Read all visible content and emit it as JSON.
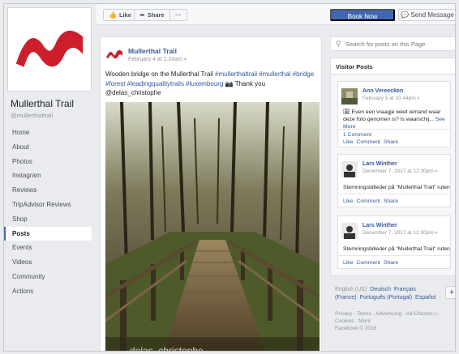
{
  "page": {
    "name": "Mullerthal Trail",
    "handle": "@mullerthaltrail"
  },
  "nav": {
    "items": [
      "Home",
      "About",
      "Photos",
      "Instagram",
      "Reviews",
      "TripAdvisor Reviews",
      "Shop",
      "Posts",
      "Events",
      "Videos",
      "Community",
      "Actions"
    ],
    "active": "Posts"
  },
  "actionbar": {
    "like_label": "Like",
    "share_label": "Share",
    "more_label": "···",
    "book_label": "Book Now",
    "message_label": "Send Message"
  },
  "post": {
    "author": "Mullerthal Trail",
    "date": "February 4 at 1:24am",
    "text_plain_1": "Wooden bridge on the Mullerthal Trail ",
    "tags_1": "#mullerthaltrail #mullerthal #bridge #forest #leadingqualitytrails #luxembourg",
    "text_plain_2": " Thank you @delas_christophe",
    "watermark": "delas_christophe"
  },
  "search": {
    "placeholder": "Search for posts on this Page"
  },
  "visitor_posts": {
    "title": "Visitor Posts",
    "posts": [
      {
        "name": "Ann Vereecken",
        "date": "February 5 at 10:44pm",
        "text": "Even een vraagje weet iemand waar deze foto genomen is? Is waarschij...",
        "see_more": "See More",
        "comments": "1 Comment",
        "actions": [
          "Like",
          "Comment",
          "Share"
        ]
      },
      {
        "name": "Lars Winther",
        "date": "December 7, 2017 at 12:30pm",
        "text": "Stemningsbilleder på \"Mullerthal Trail\" ruten",
        "actions": [
          "Like",
          "Comment",
          "Share"
        ]
      },
      {
        "name": "Lars Winther",
        "date": "December 7, 2017 at 12:30pm",
        "text": "Stemningsbilleder på \"Mullerthal Trail\" ruten",
        "actions": [
          "Like",
          "Comment",
          "Share"
        ]
      }
    ]
  },
  "languages": {
    "current": "English (US)",
    "others": [
      "Deutsch",
      "Français (France)",
      "Português (Portugal)",
      "Español"
    ],
    "add_label": "+"
  },
  "footer": {
    "line1": "Privacy · Terms · Advertising · Ad Choices",
    "line2": "Cookies · More",
    "line3": "Facebook © 2018"
  },
  "colors": {
    "accent": "#4267b2",
    "link": "#365899",
    "brand_red": "#cc1f2b"
  }
}
